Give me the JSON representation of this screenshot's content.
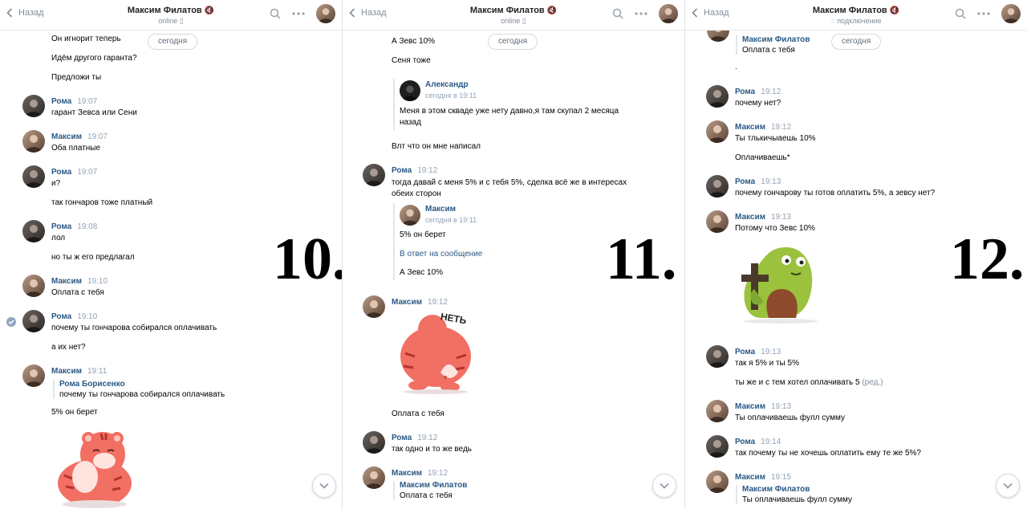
{
  "panels": [
    {
      "header": {
        "back_label": "Назад",
        "title": "Максим Филатов",
        "status": "online"
      },
      "date_pill": "сегодня",
      "big_number": "10.",
      "lines": [
        "Он игнорит теперь",
        "Идём другого гаранта?",
        "Предложи ты"
      ],
      "messages": [
        {
          "author": "Рома",
          "time": "19:07",
          "lines": [
            "гарант Зевса или Сени"
          ]
        },
        {
          "author": "Максим",
          "time": "19:07",
          "lines": [
            "Оба платные"
          ]
        },
        {
          "author": "Рома",
          "time": "19:07",
          "lines": [
            "и?",
            "так гончаров тоже платный"
          ]
        },
        {
          "author": "Рома",
          "time": "19:08",
          "lines": [
            "лол",
            "но ты ж его предлагал"
          ]
        },
        {
          "author": "Максим",
          "time": "19:10",
          "lines": [
            "Оплата с тебя"
          ]
        },
        {
          "author": "Рома",
          "time": "19:10",
          "lines": [
            "почему ты гончарова собирался оплачивать",
            "а их нет?"
          ]
        },
        {
          "author": "Максим",
          "time": "19:11",
          "quote": {
            "name": "Рома Борисенко",
            "text": "почему ты гончарова собирался оплачивать"
          },
          "lines": [
            "5% он берет"
          ]
        }
      ]
    },
    {
      "header": {
        "back_label": "Назад",
        "title": "Максим Филатов",
        "status": "online"
      },
      "date_pill": "сегодня",
      "big_number": "11.",
      "lines": [
        "А Зевс 10%",
        "Сеня тоже"
      ],
      "quote_top": {
        "name": "Александр",
        "date": "сегодня в 19:11",
        "text": "Меня в этом скваде уже нету давно,я там скупал 2 месяца назад"
      },
      "after_quote": "Влт что он мне написал",
      "messages": [
        {
          "author": "Рома",
          "time": "19:12",
          "lines": [
            "тогда давай с меня 5% и с тебя 5%, сделка всё же в интересах обеих сторон"
          ],
          "quote": {
            "name": "Максим",
            "date": "сегодня в 19:11",
            "text": "5% он берет",
            "reply_link": "В ответ на сообщение",
            "reply_text": "А Зевс 10%"
          }
        },
        {
          "author": "Максим",
          "time": "19:12",
          "sticker_text": "НЕТЬ",
          "lines": [
            "Оплата с тебя"
          ]
        },
        {
          "author": "Рома",
          "time": "19:12",
          "lines": [
            "так одно и то же ведь"
          ]
        },
        {
          "author": "Максим",
          "time": "19:12",
          "quote": {
            "name": "Максим Филатов",
            "text": "Оплата с тебя"
          }
        }
      ]
    },
    {
      "header": {
        "back_label": "Назад",
        "title": "Максим Филатов",
        "status": "подключение"
      },
      "date_pill": "сегодня",
      "big_number": "12.",
      "top_quote": {
        "name": "Максим Филатов",
        "text": "Оплата с тебя"
      },
      "dot": ".",
      "messages": [
        {
          "author": "Рома",
          "time": "19:12",
          "lines": [
            "почему нет?"
          ]
        },
        {
          "author": "Максим",
          "time": "19:12",
          "lines": [
            "Ты тлькичыаешь 10%",
            "Оплачиваешь*"
          ]
        },
        {
          "author": "Рома",
          "time": "19:13",
          "lines": [
            "почему гончарову ты готов оплатить 5%, а зевсу нет?"
          ]
        },
        {
          "author": "Максим",
          "time": "19:13",
          "lines": [
            "Потому что Зевс 10%"
          ]
        },
        {
          "author": "Рома",
          "time": "19:13",
          "lines": [
            "так я 5% и ты 5%",
            "ты же и с тем хотел оплачивать 5"
          ],
          "edited": "(ред.)"
        },
        {
          "author": "Максим",
          "time": "19:13",
          "lines": [
            "Ты оплачиваешь фулл сумму"
          ]
        },
        {
          "author": "Рома",
          "time": "19:14",
          "lines": [
            "так почему ты не хочешь оплатить ему те же 5%?"
          ]
        },
        {
          "author": "Максим",
          "time": "19:15",
          "quote": {
            "name": "Максим Филатов",
            "text": "Ты оплачиваешь фулл сумму"
          }
        }
      ]
    }
  ],
  "icons": {
    "back": "chevron-left-icon",
    "search": "search-icon",
    "more": "more-dots-icon",
    "scroll": "chevron-down-icon"
  },
  "colors": {
    "accent": "#2a5885",
    "muted": "#818c99",
    "time": "#93a3b5"
  }
}
